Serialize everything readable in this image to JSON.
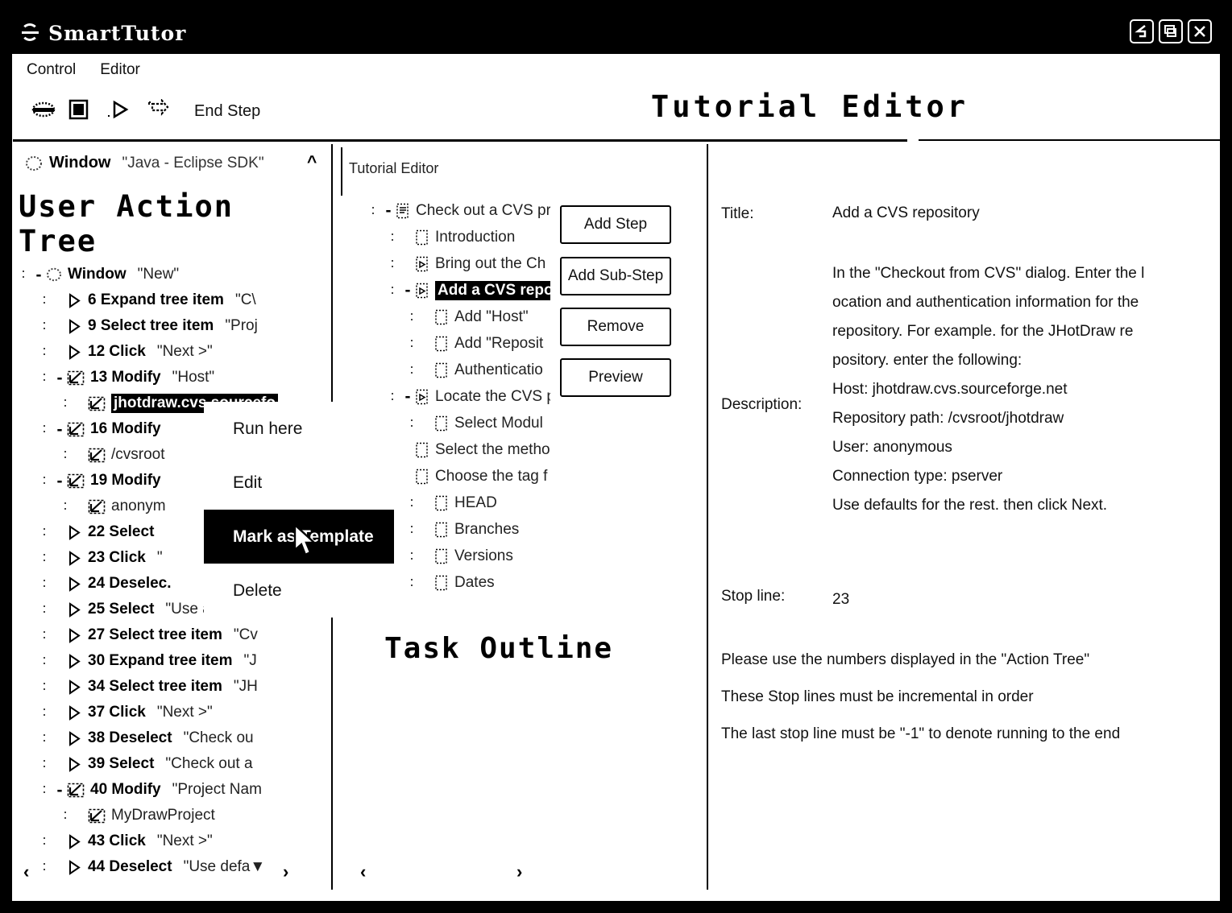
{
  "window": {
    "title": "SmartTutor",
    "buttons": [
      "minimize",
      "maximize",
      "close"
    ]
  },
  "menubar": {
    "items": [
      "Control",
      "Editor"
    ]
  },
  "toolbar": {
    "icons": [
      "record-icon",
      "stop-icon",
      "step-icon",
      "run-icon"
    ],
    "end_step_label": "End Step"
  },
  "header": {
    "title": "Tutorial Editor"
  },
  "left_panel": {
    "tab_icon": "window-icon",
    "tab_label": "Window",
    "tab_value": "\"Java - Eclipse SDK\"",
    "collapse_icon": "chevron-up-icon",
    "section_title": "User Action Tree",
    "tree": [
      {
        "indent": 0,
        "toggle": "-",
        "icon": "window-icon",
        "label": "Window",
        "value": "\"New\""
      },
      {
        "indent": 1,
        "toggle": "",
        "icon": "play-icon",
        "label": "6 Expand tree item",
        "value": "\"C\\"
      },
      {
        "indent": 1,
        "toggle": "",
        "icon": "play-icon",
        "label": "9 Select tree item",
        "value": "\"Proj"
      },
      {
        "indent": 1,
        "toggle": "",
        "icon": "play-icon",
        "label": "12 Click",
        "value": "\"Next >\""
      },
      {
        "indent": 1,
        "toggle": "-",
        "icon": "edit-icon",
        "label": "13 Modify",
        "value": "\"Host\""
      },
      {
        "indent": 2,
        "toggle": "",
        "icon": "edit-icon",
        "label": "jhotdraw.cvs.sourcefo",
        "value": "",
        "selected": true
      },
      {
        "indent": 1,
        "toggle": "-",
        "icon": "edit-icon",
        "label": "16 Modify",
        "value": ""
      },
      {
        "indent": 2,
        "toggle": "",
        "icon": "edit-icon",
        "label": "/cvsroot",
        "value": "",
        "plain": true
      },
      {
        "indent": 1,
        "toggle": "-",
        "icon": "edit-icon",
        "label": "19 Modify",
        "value": ""
      },
      {
        "indent": 2,
        "toggle": "",
        "icon": "edit-icon",
        "label": "anonym",
        "value": "",
        "plain": true
      },
      {
        "indent": 1,
        "toggle": "",
        "icon": "play-icon",
        "label": "22 Select",
        "value": ""
      },
      {
        "indent": 1,
        "toggle": "",
        "icon": "play-icon",
        "label": "23 Click",
        "value": "\""
      },
      {
        "indent": 1,
        "toggle": "",
        "icon": "play-icon",
        "label": "24 Deselec.",
        "value": ""
      },
      {
        "indent": 1,
        "toggle": "",
        "icon": "play-icon",
        "label": "25 Select",
        "value": "\"Use an exis"
      },
      {
        "indent": 1,
        "toggle": "",
        "icon": "play-icon",
        "label": "27 Select tree item",
        "value": "\"Cv"
      },
      {
        "indent": 1,
        "toggle": "",
        "icon": "play-icon",
        "label": "30 Expand tree item",
        "value": "\"J"
      },
      {
        "indent": 1,
        "toggle": "",
        "icon": "play-icon",
        "label": "34 Select tree item",
        "value": "\"JH"
      },
      {
        "indent": 1,
        "toggle": "",
        "icon": "play-icon",
        "label": "37 Click",
        "value": "\"Next >\""
      },
      {
        "indent": 1,
        "toggle": "",
        "icon": "play-icon",
        "label": "38 Deselect",
        "value": "\"Check ou"
      },
      {
        "indent": 1,
        "toggle": "",
        "icon": "play-icon",
        "label": "39 Select",
        "value": "\"Check out a"
      },
      {
        "indent": 1,
        "toggle": "-",
        "icon": "edit-icon",
        "label": "40 Modify",
        "value": "\"Project Nam"
      },
      {
        "indent": 2,
        "toggle": "",
        "icon": "edit-icon",
        "label": "MyDrawProject",
        "value": "",
        "plain": true
      },
      {
        "indent": 1,
        "toggle": "",
        "icon": "play-icon",
        "label": "43 Click",
        "value": "\"Next >\""
      },
      {
        "indent": 1,
        "toggle": "",
        "icon": "play-icon",
        "label": "44 Deselect",
        "value": "\"Use defa▼"
      }
    ],
    "scroll_left": "‹",
    "scroll_right": "›"
  },
  "context_menu": {
    "items": [
      {
        "label": "Run here",
        "selected": false
      },
      {
        "label": "Edit",
        "selected": false
      },
      {
        "label": "Mark as Template",
        "selected": true
      },
      {
        "label": "Delete",
        "selected": false
      }
    ]
  },
  "mid_panel": {
    "tab_label": "Tutorial Editor",
    "section_title": "Task Outline",
    "tree": [
      {
        "indent": 0,
        "toggle": "-",
        "icon": "doc-expanded-icon",
        "label": "Check out a CVS pr"
      },
      {
        "indent": 1,
        "toggle": "",
        "icon": "doc-icon",
        "label": "Introduction"
      },
      {
        "indent": 1,
        "toggle": "",
        "icon": "doc-play-icon",
        "label": "Bring out the Ch"
      },
      {
        "indent": 1,
        "toggle": "-",
        "icon": "doc-play-icon",
        "label": "Add a CVS repos",
        "selected": true
      },
      {
        "indent": 2,
        "toggle": "",
        "icon": "doc-icon",
        "label": "Add \"Host\""
      },
      {
        "indent": 2,
        "toggle": "",
        "icon": "doc-icon",
        "label": "Add \"Reposit"
      },
      {
        "indent": 2,
        "toggle": "",
        "icon": "doc-icon",
        "label": "Authenticatio"
      },
      {
        "indent": 1,
        "toggle": "-",
        "icon": "doc-play-icon",
        "label": "Locate the CVS p"
      },
      {
        "indent": 2,
        "toggle": "",
        "icon": "doc-icon",
        "label": "Select Modul"
      },
      {
        "indent": 1,
        "toggle": "",
        "icon": "doc-icon",
        "label": "Select the metho"
      },
      {
        "indent": 1,
        "toggle": "",
        "icon": "doc-icon",
        "label": "Choose the tag f"
      },
      {
        "indent": 2,
        "toggle": "",
        "icon": "doc-icon",
        "label": "HEAD"
      },
      {
        "indent": 2,
        "toggle": "",
        "icon": "doc-icon",
        "label": "Branches"
      },
      {
        "indent": 2,
        "toggle": "",
        "icon": "doc-icon",
        "label": "Versions"
      },
      {
        "indent": 2,
        "toggle": "",
        "icon": "doc-icon",
        "label": "Dates"
      }
    ],
    "buttons": [
      "Add Step",
      "Add Sub-Step",
      "Remove",
      "Preview"
    ],
    "scroll_left": "‹",
    "scroll_right": "›"
  },
  "right_panel": {
    "title_label": "Title:",
    "title_value": "Add a CVS repository",
    "description_label": "Description:",
    "description_lines": [
      "In the \"Checkout from CVS\" dialog. Enter the l",
      "ocation and authentication information for the",
      " repository. For example. for the JHotDraw re",
      "pository. enter the following:",
      "Host: jhotdraw.cvs.sourceforge.net",
      "Repository path: /cvsroot/jhotdraw",
      "User: anonymous",
      "Connection type: pserver",
      "Use defaults for the rest. then click Next."
    ],
    "stop_line_label": "Stop line:",
    "stop_line_value": "23",
    "hints": [
      "Please use the numbers displayed in the \"Action Tree\"",
      "These Stop lines must be incremental in order",
      "The last stop line must be \"-1\" to denote running to the end"
    ]
  }
}
